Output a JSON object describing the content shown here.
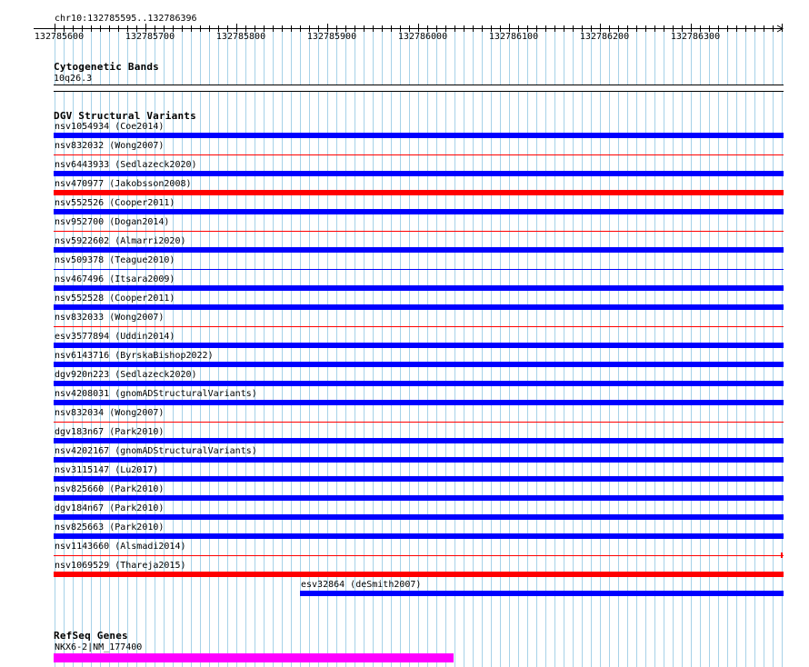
{
  "ruler": {
    "position": "chr10:132785595..132786396",
    "ticks": [
      "132785600",
      "132785700",
      "132785800",
      "132785900",
      "132786000",
      "132786100",
      "132786200",
      "132786300"
    ]
  },
  "tracks": {
    "cytoband": {
      "title": "Cytogenetic Bands",
      "band": "10q26.3"
    },
    "dgv": {
      "title": "DGV Structural Variants",
      "features": [
        {
          "label": "nsv1054934 (Coe2014)",
          "color": "#0000ff",
          "style": "thick"
        },
        {
          "label": "nsv832032 (Wong2007)",
          "color": "#ff0000",
          "style": "thin"
        },
        {
          "label": "nsv6443933 (Sedlazeck2020)",
          "color": "#0000ff",
          "style": "thick"
        },
        {
          "label": "nsv470977 (Jakobsson2008)",
          "color": "#ff0000",
          "style": "thick"
        },
        {
          "label": "nsv552526 (Cooper2011)",
          "color": "#0000ff",
          "style": "thick"
        },
        {
          "label": "nsv952700 (Dogan2014)",
          "color": "#ff0000",
          "style": "thin"
        },
        {
          "label": "nsv5922602 (Almarri2020)",
          "color": "#0000ff",
          "style": "thick"
        },
        {
          "label": "nsv509378 (Teague2010)",
          "color": "#0000ff",
          "style": "thin"
        },
        {
          "label": "nsv467496 (Itsara2009)",
          "color": "#0000ff",
          "style": "thick"
        },
        {
          "label": "nsv552528 (Cooper2011)",
          "color": "#0000ff",
          "style": "thick"
        },
        {
          "label": "nsv832033 (Wong2007)",
          "color": "#ff0000",
          "style": "thin"
        },
        {
          "label": "esv3577894 (Uddin2014)",
          "color": "#0000ff",
          "style": "thick"
        },
        {
          "label": "nsv6143716 (ByrskaBishop2022)",
          "color": "#0000ff",
          "style": "thick"
        },
        {
          "label": "dgv920n223 (Sedlazeck2020)",
          "color": "#0000ff",
          "style": "thick"
        },
        {
          "label": "nsv4208031 (gnomADStructuralVariants)",
          "color": "#0000ff",
          "style": "thick"
        },
        {
          "label": "nsv832034 (Wong2007)",
          "color": "#ff0000",
          "style": "thin"
        },
        {
          "label": "dgv183n67 (Park2010)",
          "color": "#0000ff",
          "style": "thick"
        },
        {
          "label": "nsv4202167 (gnomADStructuralVariants)",
          "color": "#0000ff",
          "style": "thick"
        },
        {
          "label": "nsv3115147 (Lu2017)",
          "color": "#0000ff",
          "style": "thick"
        },
        {
          "label": "nsv825660 (Park2010)",
          "color": "#0000ff",
          "style": "thick"
        },
        {
          "label": "dgv184n67 (Park2010)",
          "color": "#0000ff",
          "style": "thick"
        },
        {
          "label": "nsv825663 (Park2010)",
          "color": "#0000ff",
          "style": "thick"
        },
        {
          "label": "nsv1143660 (Alsmadi2014)",
          "color": "#ff0000",
          "style": "thin-end"
        },
        {
          "label": "nsv1069529 (Thareja2015)",
          "color": "#ff0000",
          "style": "thick"
        },
        {
          "label": "esv32864 (deSmith2007)",
          "color": "#0000ff",
          "style": "thick-partial"
        }
      ]
    },
    "refseq": {
      "title": "RefSeq Genes",
      "gene": "NKX6-2|NM_177400",
      "color": "#ff00ff"
    }
  }
}
